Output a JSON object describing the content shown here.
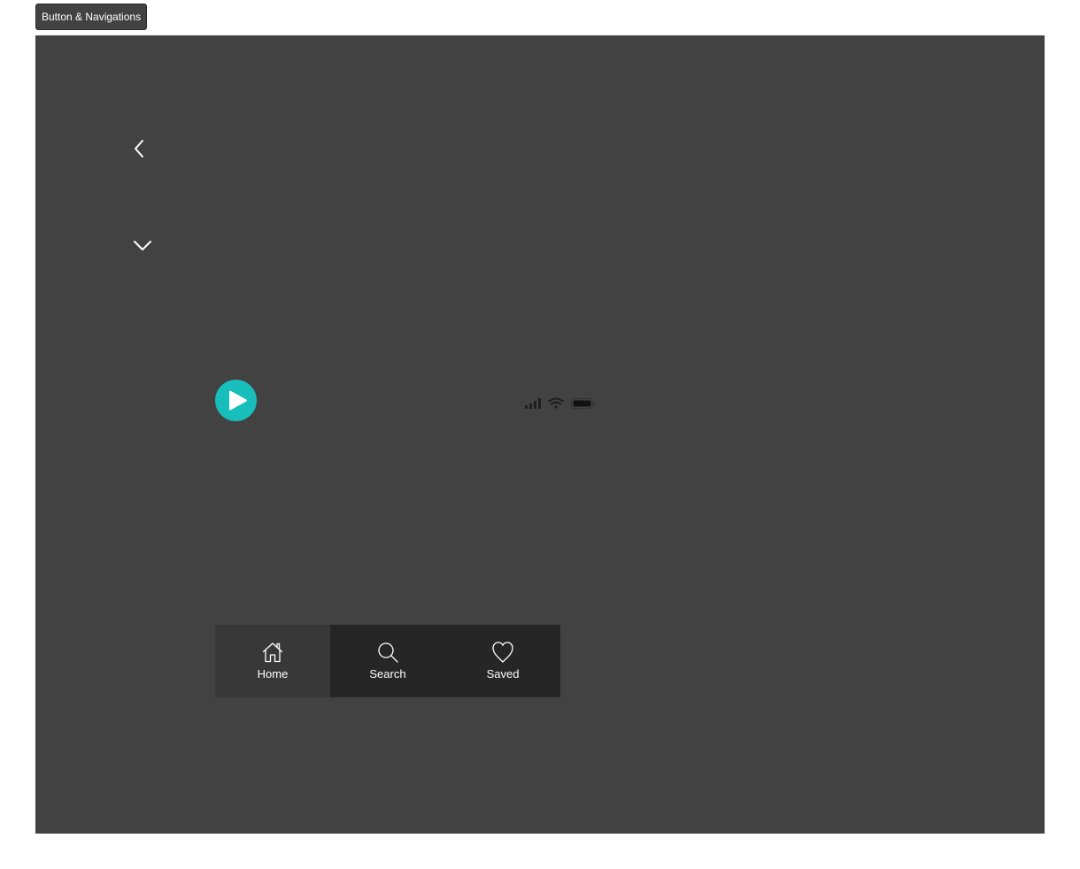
{
  "frame": {
    "title": "Button & Navigations"
  },
  "colors": {
    "canvas": "#424242",
    "accent": "#17bebb",
    "nav_bg": "#262626",
    "nav_active_bg": "#383838"
  },
  "icons": {
    "back": "chevron-left-icon",
    "expand": "chevron-down-icon",
    "play": "play-icon",
    "status": [
      "cellular-signal-icon",
      "wifi-icon",
      "battery-icon"
    ]
  },
  "bottom_nav": {
    "items": [
      {
        "label": "Home",
        "icon": "home-icon",
        "active": true
      },
      {
        "label": "Search",
        "icon": "search-icon",
        "active": false
      },
      {
        "label": "Saved",
        "icon": "heart-icon",
        "active": false
      }
    ]
  }
}
